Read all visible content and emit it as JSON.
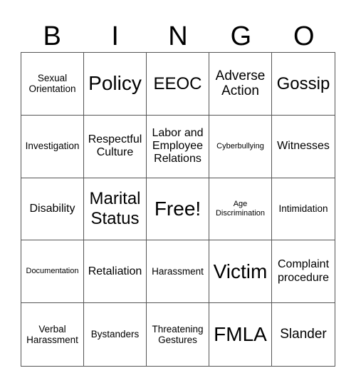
{
  "header": [
    "B",
    "I",
    "N",
    "G",
    "O"
  ],
  "cells": [
    {
      "text": "Sexual Orientation",
      "size": "s-s"
    },
    {
      "text": "Policy",
      "size": "s-xxl"
    },
    {
      "text": "EEOC",
      "size": "s-xl"
    },
    {
      "text": "Adverse Action",
      "size": "s-l"
    },
    {
      "text": "Gossip",
      "size": "s-xl"
    },
    {
      "text": "Investigation",
      "size": "s-s"
    },
    {
      "text": "Respectful Culture",
      "size": "s-m"
    },
    {
      "text": "Labor and Employee Relations",
      "size": "s-m"
    },
    {
      "text": "Cyberbullying",
      "size": "s-xs"
    },
    {
      "text": "Witnesses",
      "size": "s-m"
    },
    {
      "text": "Disability",
      "size": "s-m"
    },
    {
      "text": "Marital Status",
      "size": "s-xl"
    },
    {
      "text": "Free!",
      "size": "s-xxl"
    },
    {
      "text": "Age Discrimination",
      "size": "s-xs"
    },
    {
      "text": "Intimidation",
      "size": "s-s"
    },
    {
      "text": "Documentation",
      "size": "s-xs"
    },
    {
      "text": "Retaliation",
      "size": "s-m"
    },
    {
      "text": "Harassment",
      "size": "s-s"
    },
    {
      "text": "Victim",
      "size": "s-xxl"
    },
    {
      "text": "Complaint procedure",
      "size": "s-m"
    },
    {
      "text": "Verbal Harassment",
      "size": "s-s"
    },
    {
      "text": "Bystanders",
      "size": "s-s"
    },
    {
      "text": "Threatening Gestures",
      "size": "s-s"
    },
    {
      "text": "FMLA",
      "size": "s-xxl"
    },
    {
      "text": "Slander",
      "size": "s-l"
    }
  ]
}
